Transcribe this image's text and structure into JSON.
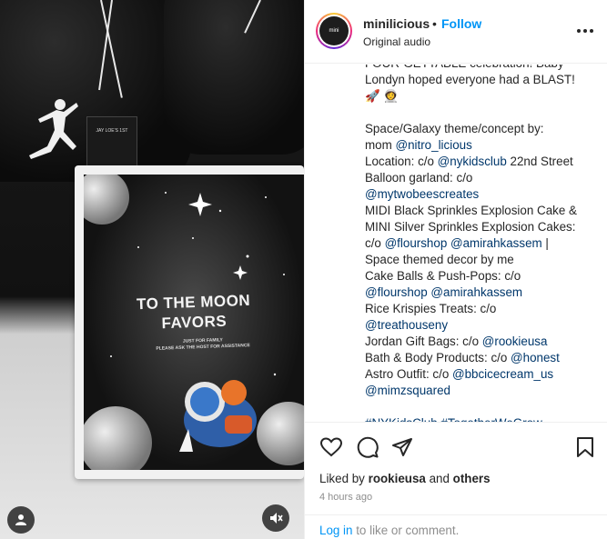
{
  "post": {
    "username": "minilicious",
    "separator": "•",
    "follow_label": "Follow",
    "audio_label": "Original audio",
    "avatar_text": "mini"
  },
  "media": {
    "tag_text": "JAY LOE'S 1ST",
    "sign_title_1": "TO THE MOON",
    "sign_title_2": "FAVORS",
    "sign_sub_1": "JUST FOR FAMILY",
    "sign_sub_2": "PLEASE ASK THE HOST FOR ASSISTANCE",
    "user_icon": "user-icon",
    "mute_icon": "muted-speaker-icon"
  },
  "caption_lines": [
    {
      "parts": [
        {
          "t": "FOUR-GETTABLE celebration! Baby"
        }
      ]
    },
    {
      "parts": [
        {
          "t": "Londyn hoped everyone had a BLAST!"
        }
      ]
    },
    {
      "parts": [
        {
          "t": "🚀 👩‍🚀"
        }
      ]
    },
    {
      "blank": true
    },
    {
      "parts": [
        {
          "t": "Space/Galaxy theme/concept by:"
        }
      ]
    },
    {
      "parts": [
        {
          "t": "mom "
        },
        {
          "t": "@nitro_licious",
          "m": true
        }
      ]
    },
    {
      "parts": [
        {
          "t": "Location: c/o "
        },
        {
          "t": "@nykidsclub",
          "m": true
        },
        {
          "t": " 22nd Street"
        }
      ]
    },
    {
      "parts": [
        {
          "t": "Balloon garland: c/o"
        }
      ]
    },
    {
      "parts": [
        {
          "t": "@mytwobeescreates",
          "m": true
        }
      ]
    },
    {
      "parts": [
        {
          "t": "MIDI Black Sprinkles Explosion Cake &"
        }
      ]
    },
    {
      "parts": [
        {
          "t": "MINI Silver Sprinkles Explosion Cakes:"
        }
      ]
    },
    {
      "parts": [
        {
          "t": "c/o "
        },
        {
          "t": "@flourshop",
          "m": true
        },
        {
          "t": " "
        },
        {
          "t": "@amirahkassem",
          "m": true
        },
        {
          "t": " |"
        }
      ]
    },
    {
      "parts": [
        {
          "t": "Space themed decor by me"
        }
      ]
    },
    {
      "parts": [
        {
          "t": "Cake Balls & Push-Pops: c/o"
        }
      ]
    },
    {
      "parts": [
        {
          "t": "@flourshop",
          "m": true
        },
        {
          "t": " "
        },
        {
          "t": "@amirahkassem",
          "m": true
        }
      ]
    },
    {
      "parts": [
        {
          "t": "Rice Krispies Treats: c/o"
        }
      ]
    },
    {
      "parts": [
        {
          "t": "@treathouseny",
          "m": true
        }
      ]
    },
    {
      "parts": [
        {
          "t": "Jordan Gift Bags: c/o "
        },
        {
          "t": "@rookieusa",
          "m": true
        }
      ]
    },
    {
      "parts": [
        {
          "t": "Bath & Body Products: c/o "
        },
        {
          "t": "@honest",
          "m": true
        }
      ]
    },
    {
      "parts": [
        {
          "t": "Astro Outfit: c/o "
        },
        {
          "t": "@bbcicecream_us",
          "m": true
        }
      ]
    },
    {
      "parts": [
        {
          "t": "@mimzsquared",
          "m": true
        }
      ]
    },
    {
      "blank": true
    },
    {
      "parts": [
        {
          "t": "#NYKidsClub",
          "m": true
        },
        {
          "t": " "
        },
        {
          "t": "#TogetherWeGrow",
          "m": true
        }
      ]
    }
  ],
  "actions": {
    "like_icon": "heart-icon",
    "comment_icon": "comment-icon",
    "share_icon": "share-icon",
    "save_icon": "bookmark-icon"
  },
  "likes": {
    "prefix": "Liked by ",
    "user": "rookieusa",
    "middle": " and ",
    "others": "others"
  },
  "timestamp": "4 hours ago",
  "login": {
    "link": "Log in",
    "rest": " to like or comment."
  },
  "colors": {
    "link": "#0095f6",
    "mention": "#00376b",
    "text": "#262626",
    "muted": "#8e8e8e"
  }
}
